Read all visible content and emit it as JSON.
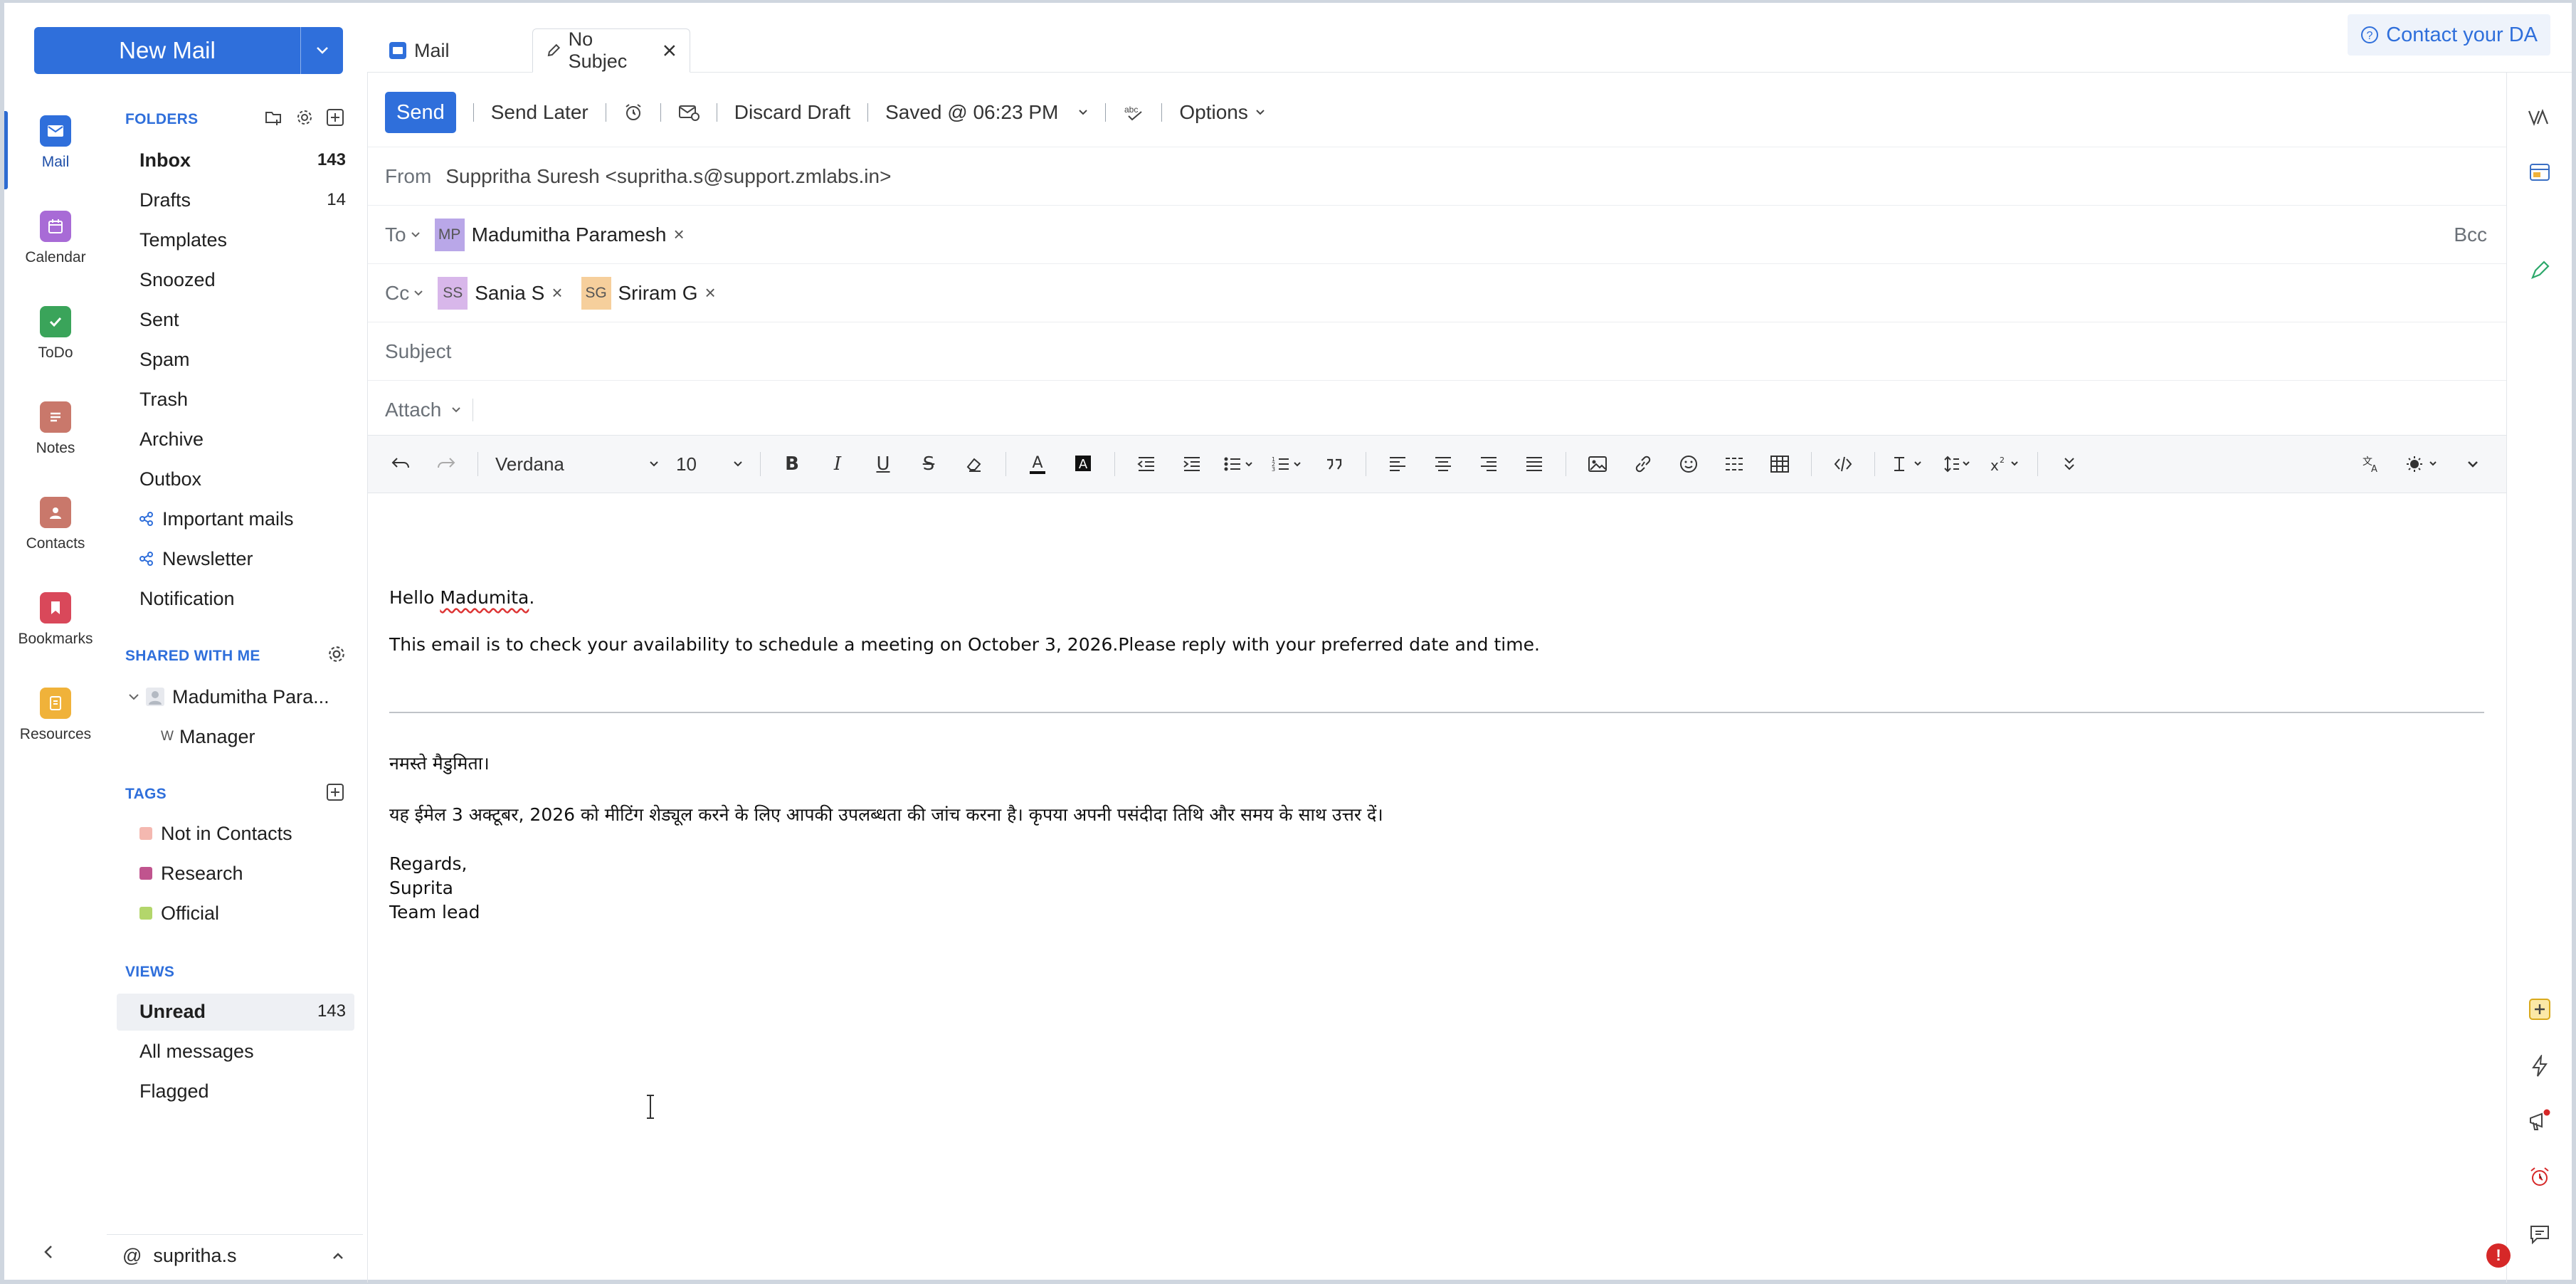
{
  "new_mail_label": "New Mail",
  "rail": [
    {
      "label": "Mail",
      "icon": "mail-icon",
      "color": "#2f6fdb"
    },
    {
      "label": "Calendar",
      "icon": "calendar-icon",
      "color": "#a86bd6"
    },
    {
      "label": "ToDo",
      "icon": "todo-icon",
      "color": "#3aa45a"
    },
    {
      "label": "Notes",
      "icon": "notes-icon",
      "color": "#c9786b"
    },
    {
      "label": "Contacts",
      "icon": "contacts-icon",
      "color": "#c9786b"
    },
    {
      "label": "Bookmarks",
      "icon": "bookmarks-icon",
      "color": "#d9485a"
    },
    {
      "label": "Resources",
      "icon": "resources-icon",
      "color": "#f0b23a"
    }
  ],
  "folders": {
    "title": "FOLDERS",
    "items": [
      {
        "label": "Inbox",
        "count": "143"
      },
      {
        "label": "Drafts",
        "count": "14"
      },
      {
        "label": "Templates",
        "count": ""
      },
      {
        "label": "Snoozed",
        "count": ""
      },
      {
        "label": "Sent",
        "count": ""
      },
      {
        "label": "Spam",
        "count": ""
      },
      {
        "label": "Trash",
        "count": ""
      },
      {
        "label": "Archive",
        "count": ""
      },
      {
        "label": "Outbox",
        "count": ""
      },
      {
        "label": "Important mails",
        "count": ""
      },
      {
        "label": "Newsletter",
        "count": ""
      },
      {
        "label": "Notification",
        "count": ""
      }
    ]
  },
  "shared": {
    "title": "SHARED WITH ME",
    "owner": "Madumitha Para...",
    "sub_prefix": "W",
    "sub": "Manager"
  },
  "tags": {
    "title": "TAGS",
    "items": [
      {
        "label": "Not in Contacts",
        "color": "#f4b8b0"
      },
      {
        "label": "Research",
        "color": "#c0548e"
      },
      {
        "label": "Official",
        "color": "#b3d66b"
      }
    ]
  },
  "views": {
    "title": "VIEWS",
    "items": [
      {
        "label": "Unread",
        "count": "143"
      },
      {
        "label": "All messages",
        "count": ""
      },
      {
        "label": "Flagged",
        "count": ""
      }
    ]
  },
  "user": {
    "at": "@",
    "name": "supritha.s"
  },
  "tabs": [
    {
      "label": "Mail"
    },
    {
      "label": "No Subjec"
    }
  ],
  "contact_da": "Contact your DA",
  "toolbar": {
    "send": "Send",
    "send_later": "Send Later",
    "discard": "Discard Draft",
    "saved": "Saved @ 06:23 PM",
    "options": "Options"
  },
  "from": {
    "label": "From",
    "value": "Suppritha Suresh <supritha.s@support.zmlabs.in>"
  },
  "to": {
    "label": "To",
    "bcc": "Bcc",
    "chips": [
      {
        "initials": "MP",
        "name": "Madumitha Paramesh",
        "color": "#b9a7e8"
      }
    ]
  },
  "cc": {
    "label": "Cc",
    "chips": [
      {
        "initials": "SS",
        "name": "Sania S",
        "color": "#d8b7ea"
      },
      {
        "initials": "SG",
        "name": "Sriram G",
        "color": "#f6cf9c"
      }
    ]
  },
  "subject": {
    "placeholder": "Subject"
  },
  "attach": {
    "label": "Attach"
  },
  "format": {
    "font": "Verdana",
    "size": "10"
  },
  "body": {
    "greeting_prefix": "Hello ",
    "greeting_name": "Madumita",
    "greeting_suffix": ".",
    "line1": "This email is to check your availability to schedule a meeting on October 3, 2026.Please reply with your preferred date and time.",
    "hindi_greeting": "नमस्ते मैडुमिता।",
    "hindi_line": "यह ईमेल 3 अक्टूबर, 2026 को मीटिंग शेड्यूल करने के लिए आपकी उपलब्धता की जांच करना है। कृपया अपनी पसंदीदा तिथि और समय के साथ उत्तर दें।",
    "regards": "Regards,",
    "sign_name": "Suprita",
    "sign_title": "Team lead"
  },
  "error_badge": "!"
}
